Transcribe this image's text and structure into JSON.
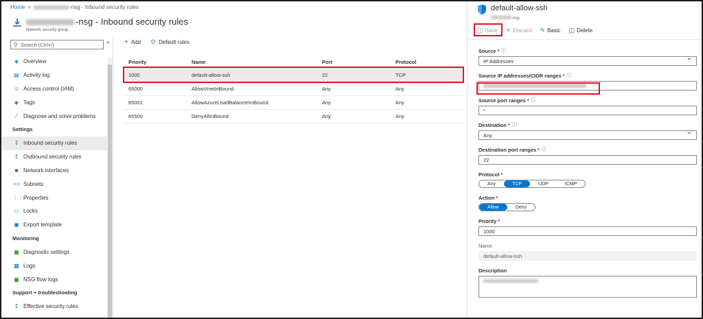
{
  "breadcrumb": {
    "home": "Home",
    "current": "-nsg - Inbound security rules"
  },
  "header": {
    "title": "-nsg - Inbound security rules",
    "subtitle": "Network security group"
  },
  "search": {
    "placeholder": "Search (Ctrl+/)"
  },
  "sidebar": {
    "items": [
      {
        "label": "Overview",
        "icon": "overview-icon"
      },
      {
        "label": "Activity log",
        "icon": "activity-log-icon"
      },
      {
        "label": "Access control (IAM)",
        "icon": "iam-icon"
      },
      {
        "label": "Tags",
        "icon": "tag-icon"
      },
      {
        "label": "Diagnose and solve problems",
        "icon": "wrench-icon"
      }
    ],
    "settings_header": "Settings",
    "settings": [
      {
        "label": "Inbound security rules",
        "icon": "inbound-icon"
      },
      {
        "label": "Outbound security rules",
        "icon": "outbound-icon"
      },
      {
        "label": "Network interfaces",
        "icon": "nic-icon"
      },
      {
        "label": "Subnets",
        "icon": "subnet-icon"
      },
      {
        "label": "Properties",
        "icon": "properties-icon"
      },
      {
        "label": "Locks",
        "icon": "lock-icon"
      },
      {
        "label": "Export template",
        "icon": "export-icon"
      }
    ],
    "monitoring_header": "Monitoring",
    "monitoring": [
      {
        "label": "Diagnostic settings",
        "icon": "diagnostic-icon"
      },
      {
        "label": "Logs",
        "icon": "logs-icon"
      },
      {
        "label": "NSG flow logs",
        "icon": "flow-logs-icon"
      }
    ],
    "support_header": "Support + troubleshooting",
    "support": [
      {
        "label": "Effective security rules",
        "icon": "effective-rules-icon"
      }
    ]
  },
  "toolbar": {
    "add": "Add",
    "default_rules": "Default rules"
  },
  "table": {
    "columns": [
      "Priority",
      "Name",
      "Port",
      "Protocol"
    ],
    "rows": [
      {
        "priority": "1000",
        "name": "default-allow-ssh",
        "port": "22",
        "protocol": "TCP"
      },
      {
        "priority": "65000",
        "name": "AllowVnetInBound",
        "port": "Any",
        "protocol": "Any"
      },
      {
        "priority": "65001",
        "name": "AllowAzureLoadBalancerInBound",
        "port": "Any",
        "protocol": "Any"
      },
      {
        "priority": "65500",
        "name": "DenyAllInBound",
        "port": "Any",
        "protocol": "Any"
      }
    ]
  },
  "blade": {
    "title": "default-allow-ssh",
    "subtitle": "-nsg",
    "save": "Save",
    "discard": "Discard",
    "basic": "Basic",
    "delete": "Delete",
    "source_label": "Source",
    "source_value": "IP Addresses",
    "source_ip_label": "Source IP addresses/CIDR ranges",
    "source_port_label": "Source port ranges",
    "source_port_value": "*",
    "destination_label": "Destination",
    "destination_value": "Any",
    "dest_port_label": "Destination port ranges",
    "dest_port_value": "22",
    "protocol_label": "Protocol",
    "protocol_options": [
      "Any",
      "TCP",
      "UDP",
      "ICMP"
    ],
    "protocol_selected": "TCP",
    "action_label": "Action",
    "action_options": [
      "Allow",
      "Deny"
    ],
    "action_selected": "Allow",
    "priority_label": "Priority",
    "priority_value": "1000",
    "name_label": "Name",
    "name_value": "default-allow-ssh",
    "description_label": "Description",
    "required_marker": "*",
    "info_marker": "ⓘ"
  },
  "colors": {
    "accent": "#0078d4",
    "highlight": "#e81123"
  }
}
